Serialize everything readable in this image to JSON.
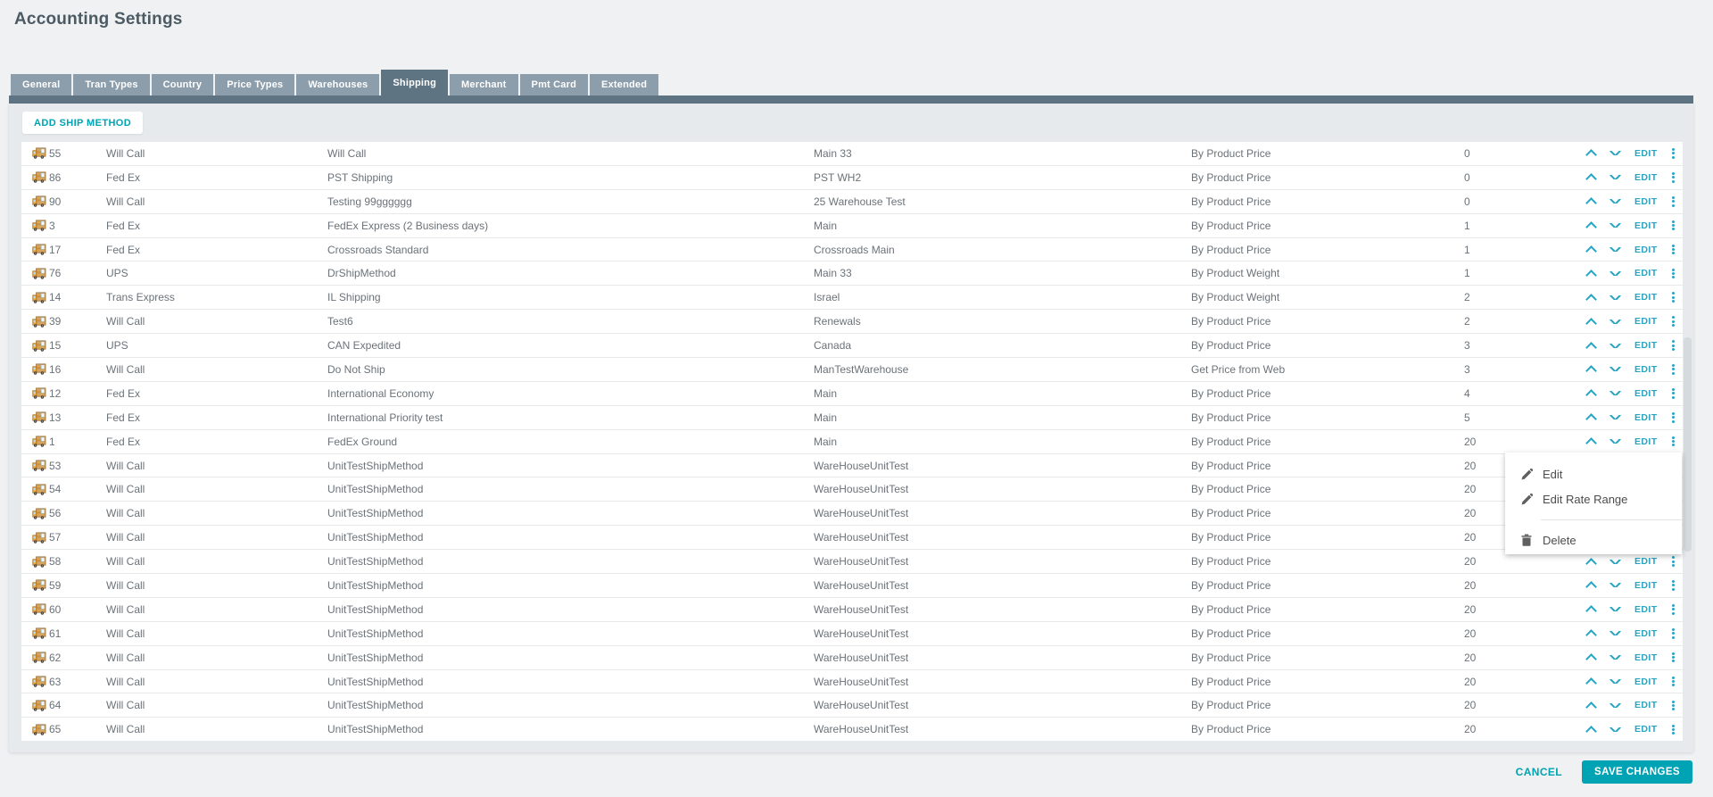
{
  "colors": {
    "accent": "#00a3b4",
    "link": "#26a5c4",
    "tab_active": "#5e7482",
    "tab_inactive": "#8c9dab"
  },
  "page": {
    "title": "Accounting Settings"
  },
  "tabs": [
    {
      "label": "General"
    },
    {
      "label": "Tran Types"
    },
    {
      "label": "Country"
    },
    {
      "label": "Price Types"
    },
    {
      "label": "Warehouses"
    },
    {
      "label": "Shipping",
      "active": true
    },
    {
      "label": "Merchant"
    },
    {
      "label": "Pmt Card"
    },
    {
      "label": "Extended"
    }
  ],
  "shipping_tab": {
    "add_button_label": "ADD SHIP METHOD",
    "edit_label": "EDIT",
    "icons": {
      "row_icon": "truck-icon",
      "move_up": "chevron-up-icon",
      "move_down": "chevron-down-icon",
      "more_actions": "kebab-icon"
    },
    "rows": [
      {
        "id": "55",
        "carrier": "Will Call",
        "method": "Will Call",
        "warehouse": "Main 33",
        "price_type": "By Product Price",
        "sort": "0"
      },
      {
        "id": "86",
        "carrier": "Fed Ex",
        "method": "PST Shipping",
        "warehouse": "PST WH2",
        "price_type": "By Product Price",
        "sort": "0"
      },
      {
        "id": "90",
        "carrier": "Will Call",
        "method": "Testing 99gggggg",
        "warehouse": "25 Warehouse Test",
        "price_type": "By Product Price",
        "sort": "0"
      },
      {
        "id": "3",
        "carrier": "Fed Ex",
        "method": "FedEx Express (2 Business days)",
        "warehouse": "Main",
        "price_type": "By Product Price",
        "sort": "1"
      },
      {
        "id": "17",
        "carrier": "Fed Ex",
        "method": "Crossroads Standard",
        "warehouse": "Crossroads Main",
        "price_type": "By Product Price",
        "sort": "1"
      },
      {
        "id": "76",
        "carrier": "UPS",
        "method": "DrShipMethod",
        "warehouse": "Main 33",
        "price_type": "By Product Weight",
        "sort": "1"
      },
      {
        "id": "14",
        "carrier": "Trans Express",
        "method": "IL Shipping",
        "warehouse": "Israel",
        "price_type": "By Product Weight",
        "sort": "2"
      },
      {
        "id": "39",
        "carrier": "Will Call",
        "method": "Test6",
        "warehouse": "Renewals",
        "price_type": "By Product Price",
        "sort": "2"
      },
      {
        "id": "15",
        "carrier": "UPS",
        "method": "CAN Expedited",
        "warehouse": "Canada",
        "price_type": "By Product Price",
        "sort": "3"
      },
      {
        "id": "16",
        "carrier": "Will Call",
        "method": "Do Not Ship",
        "warehouse": "ManTestWarehouse",
        "price_type": "Get Price from Web",
        "sort": "3"
      },
      {
        "id": "12",
        "carrier": "Fed Ex",
        "method": "International Economy",
        "warehouse": "Main",
        "price_type": "By Product Price",
        "sort": "4"
      },
      {
        "id": "13",
        "carrier": "Fed Ex",
        "method": "International Priority test",
        "warehouse": "Main",
        "price_type": "By Product Price",
        "sort": "5"
      },
      {
        "id": "1",
        "carrier": "Fed Ex",
        "method": "FedEx Ground",
        "warehouse": "Main",
        "price_type": "By Product Price",
        "sort": "20"
      },
      {
        "id": "53",
        "carrier": "Will Call",
        "method": "UnitTestShipMethod",
        "warehouse": "WareHouseUnitTest",
        "price_type": "By Product Price",
        "sort": "20"
      },
      {
        "id": "54",
        "carrier": "Will Call",
        "method": "UnitTestShipMethod",
        "warehouse": "WareHouseUnitTest",
        "price_type": "By Product Price",
        "sort": "20"
      },
      {
        "id": "56",
        "carrier": "Will Call",
        "method": "UnitTestShipMethod",
        "warehouse": "WareHouseUnitTest",
        "price_type": "By Product Price",
        "sort": "20"
      },
      {
        "id": "57",
        "carrier": "Will Call",
        "method": "UnitTestShipMethod",
        "warehouse": "WareHouseUnitTest",
        "price_type": "By Product Price",
        "sort": "20"
      },
      {
        "id": "58",
        "carrier": "Will Call",
        "method": "UnitTestShipMethod",
        "warehouse": "WareHouseUnitTest",
        "price_type": "By Product Price",
        "sort": "20"
      },
      {
        "id": "59",
        "carrier": "Will Call",
        "method": "UnitTestShipMethod",
        "warehouse": "WareHouseUnitTest",
        "price_type": "By Product Price",
        "sort": "20"
      },
      {
        "id": "60",
        "carrier": "Will Call",
        "method": "UnitTestShipMethod",
        "warehouse": "WareHouseUnitTest",
        "price_type": "By Product Price",
        "sort": "20"
      },
      {
        "id": "61",
        "carrier": "Will Call",
        "method": "UnitTestShipMethod",
        "warehouse": "WareHouseUnitTest",
        "price_type": "By Product Price",
        "sort": "20"
      },
      {
        "id": "62",
        "carrier": "Will Call",
        "method": "UnitTestShipMethod",
        "warehouse": "WareHouseUnitTest",
        "price_type": "By Product Price",
        "sort": "20"
      },
      {
        "id": "63",
        "carrier": "Will Call",
        "method": "UnitTestShipMethod",
        "warehouse": "WareHouseUnitTest",
        "price_type": "By Product Price",
        "sort": "20"
      },
      {
        "id": "64",
        "carrier": "Will Call",
        "method": "UnitTestShipMethod",
        "warehouse": "WareHouseUnitTest",
        "price_type": "By Product Price",
        "sort": "20"
      },
      {
        "id": "65",
        "carrier": "Will Call",
        "method": "UnitTestShipMethod",
        "warehouse": "WareHouseUnitTest",
        "price_type": "By Product Price",
        "sort": "20"
      }
    ]
  },
  "context_menu": {
    "items": [
      {
        "label": "Edit",
        "icon": "pencil-icon"
      },
      {
        "label": "Edit Rate Range",
        "icon": "pencil-icon"
      },
      {
        "label": "Delete",
        "icon": "trash-icon",
        "divider_before": true
      }
    ]
  },
  "footer": {
    "cancel_label": "CANCEL",
    "save_label": "SAVE CHANGES"
  }
}
